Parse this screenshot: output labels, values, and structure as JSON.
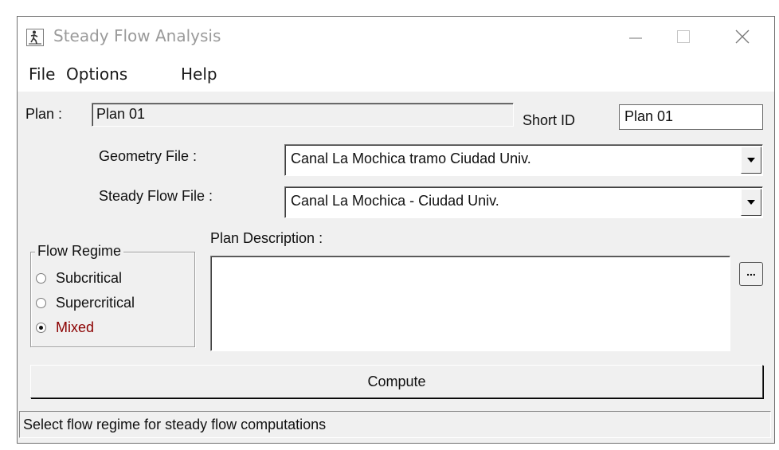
{
  "window": {
    "title": "Steady Flow Analysis"
  },
  "menu": {
    "items": [
      "File",
      "Options",
      "Help"
    ]
  },
  "plan": {
    "label": "Plan :",
    "value": "Plan 01"
  },
  "short_id": {
    "label": "Short ID",
    "value": "Plan 01"
  },
  "geometry": {
    "label": "Geometry File :",
    "selected": "Canal La Mochica tramo Ciudad Univ."
  },
  "steady_flow": {
    "label": "Steady Flow File :",
    "selected": "Canal La Mochica - Ciudad Univ."
  },
  "flow_regime": {
    "title": "Flow Regime",
    "options": [
      {
        "label": "Subcritical",
        "checked": false
      },
      {
        "label": "Supercritical",
        "checked": false
      },
      {
        "label": "Mixed",
        "checked": true
      }
    ],
    "selected_color": "#8b0000"
  },
  "description": {
    "label": "Plan Description :",
    "value": "",
    "more_button": "..."
  },
  "compute": {
    "label": "Compute"
  },
  "status": {
    "text": "Select flow regime for steady flow computations"
  },
  "icons": {
    "app": "runner-icon",
    "minimize": "minimize-icon",
    "maximize": "maximize-icon",
    "close": "close-icon",
    "dropdown": "dropdown-arrow-icon"
  }
}
